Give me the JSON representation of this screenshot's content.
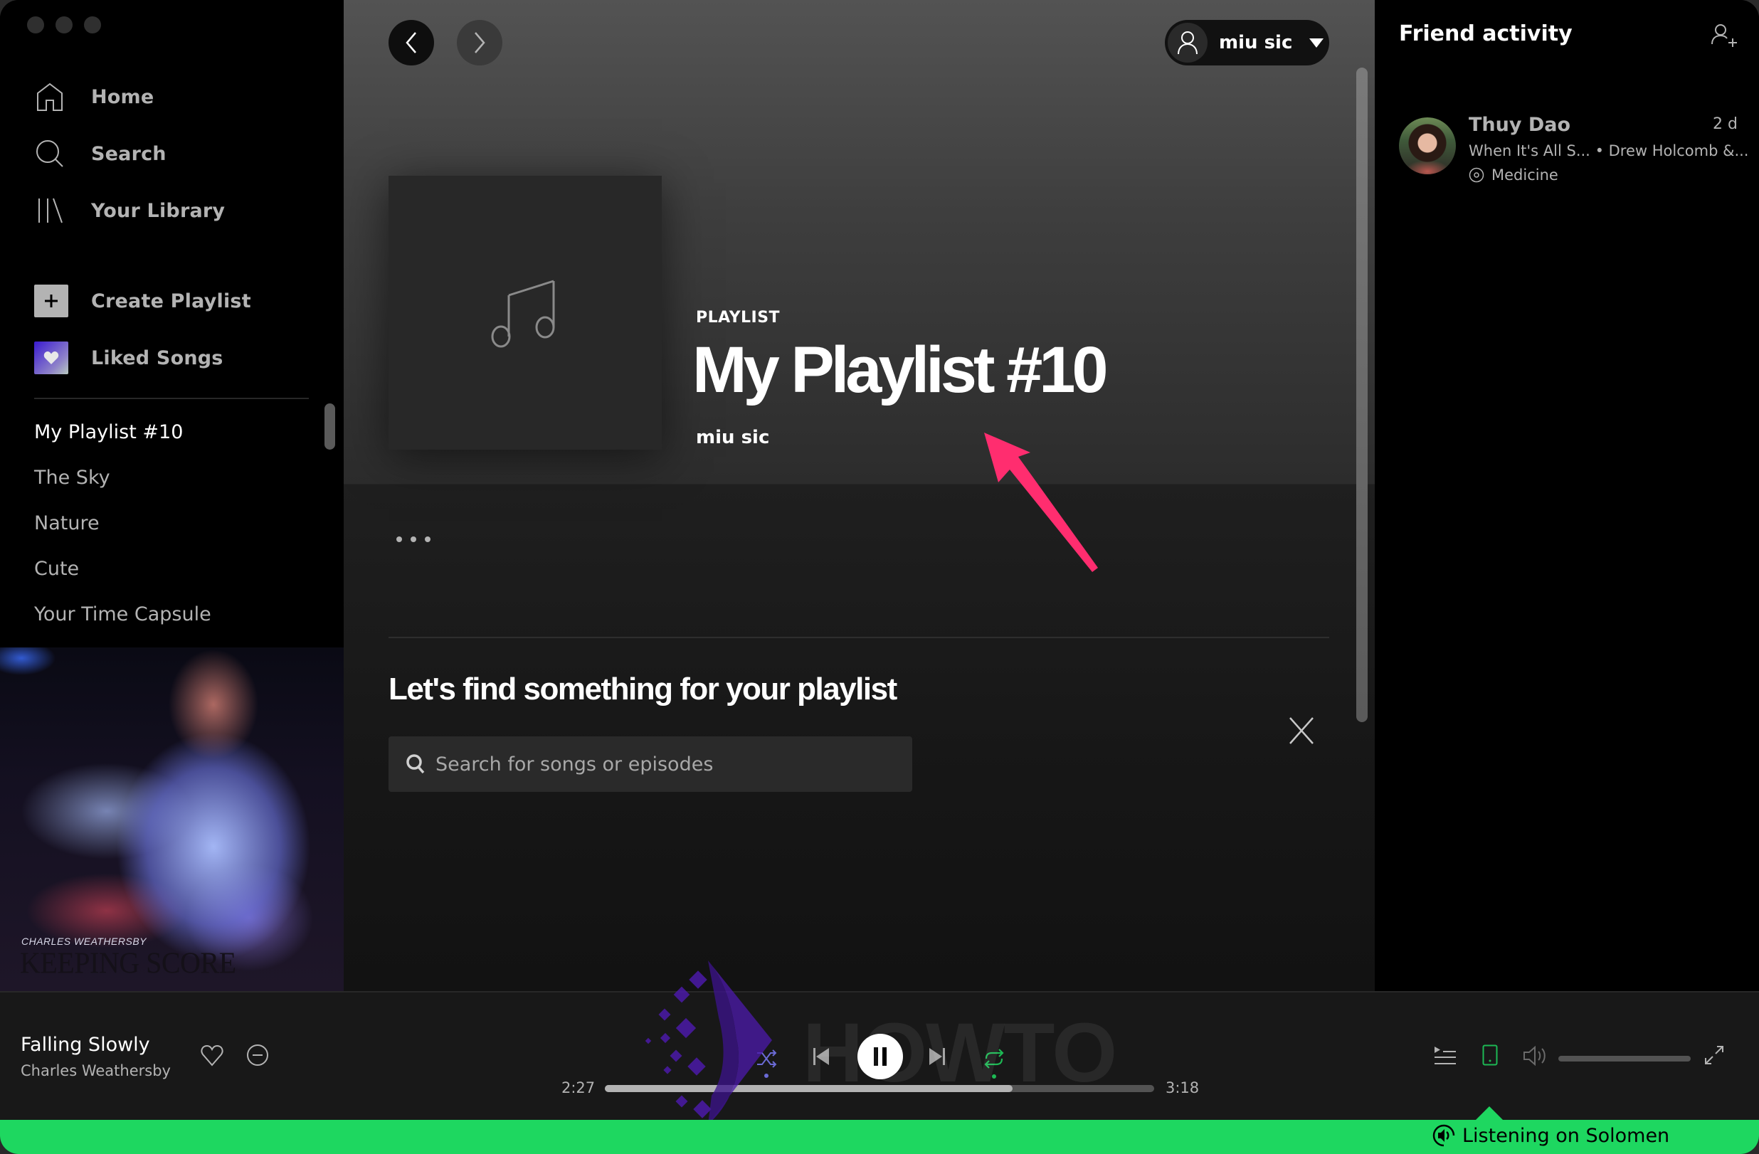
{
  "sidebar": {
    "nav": [
      {
        "label": "Home",
        "icon": "home-icon"
      },
      {
        "label": "Search",
        "icon": "search-icon"
      },
      {
        "label": "Your Library",
        "icon": "library-icon"
      }
    ],
    "actions": [
      {
        "label": "Create Playlist",
        "icon": "plus-icon"
      },
      {
        "label": "Liked Songs",
        "icon": "heart-icon"
      }
    ],
    "playlists": [
      {
        "label": "My Playlist #10",
        "active": true
      },
      {
        "label": "The Sky",
        "active": false
      },
      {
        "label": "Nature",
        "active": false
      },
      {
        "label": "Cute",
        "active": false
      },
      {
        "label": "Your Time Capsule",
        "active": false
      }
    ],
    "now_playing_art": {
      "artist": "CHARLES WEATHERSBY",
      "title": "KEEPING SCORE"
    }
  },
  "header": {
    "user_name": "miu sic"
  },
  "playlist": {
    "type_label": "PLAYLIST",
    "title": "My Playlist #10",
    "owner": "miu sic",
    "more_label": "More options"
  },
  "find": {
    "title": "Let's find something for your playlist",
    "search_placeholder": "Search for songs or episodes",
    "search_value": ""
  },
  "friends": {
    "title": "Friend activity",
    "items": [
      {
        "name": "Thuy Dao",
        "time": "2 d",
        "track": "When It's All S...",
        "separator": "•",
        "artist": "Drew Holcomb &...",
        "context": "Medicine"
      }
    ]
  },
  "player": {
    "track_title": "Falling Slowly",
    "track_artist": "Charles Weathersby",
    "elapsed": "2:27",
    "duration": "3:18",
    "progress_fraction": 0.742,
    "volume_fraction": 0.0,
    "is_playing": true,
    "shuffle_on": false,
    "repeat_on": true,
    "device_label": "Listening on Solomen"
  },
  "watermark": {
    "text": "HOWTO"
  },
  "colors": {
    "accent_green": "#1ed760",
    "annotation_pink": "#ff2d6f"
  }
}
